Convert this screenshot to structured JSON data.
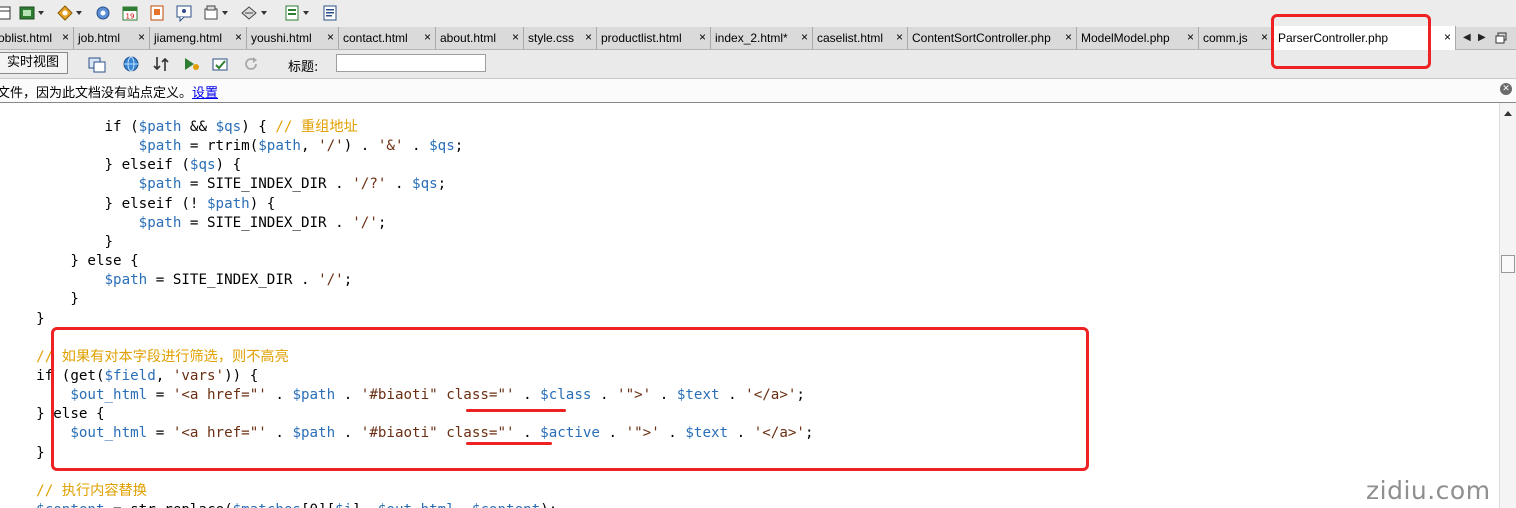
{
  "toolbar": {
    "icons": [
      "layout-icon",
      "insert-icon",
      "design-icon",
      "settings-icon",
      "calendar-icon",
      "template-icon",
      "preview-icon",
      "code-view-icon",
      "format-icon",
      "document-icon",
      "clipboard-icon"
    ]
  },
  "tabs": [
    {
      "label": "oblist.html",
      "close": "×"
    },
    {
      "label": "job.html",
      "close": "×"
    },
    {
      "label": "jiameng.html",
      "close": "×"
    },
    {
      "label": "youshi.html",
      "close": "×"
    },
    {
      "label": "contact.html",
      "close": "×"
    },
    {
      "label": "about.html",
      "close": "×"
    },
    {
      "label": "style.css",
      "close": "×"
    },
    {
      "label": "productlist.html",
      "close": "×"
    },
    {
      "label": "index_2.html*",
      "close": "×"
    },
    {
      "label": "caselist.html",
      "close": "×"
    },
    {
      "label": "ContentSortController.php",
      "close": "×"
    },
    {
      "label": "ModelModel.php",
      "close": "×"
    },
    {
      "label": "comm.js",
      "close": "×"
    },
    {
      "label": "ParserController.php",
      "close": "×"
    }
  ],
  "doc_toolbar": {
    "live_view_label": "实时视图",
    "title_label": "标题:",
    "title_value": ""
  },
  "info_bar": {
    "message": "文件，因为此文档没有站点定义。",
    "link_label": "设置"
  },
  "code_lines": [
    [
      [
        "            ",
        "o"
      ],
      [
        "if (",
        "o"
      ],
      [
        "$path",
        "v"
      ],
      [
        " && ",
        "o"
      ],
      [
        "$qs",
        "v"
      ],
      [
        ") { ",
        "o"
      ],
      [
        "// 重组地址",
        "c"
      ]
    ],
    [
      [
        "                ",
        "o"
      ],
      [
        "$path",
        "v"
      ],
      [
        " = rtrim(",
        "o"
      ],
      [
        "$path",
        "v"
      ],
      [
        ", ",
        "o"
      ],
      [
        "'/'",
        "s"
      ],
      [
        ") . ",
        "o"
      ],
      [
        "'&'",
        "s"
      ],
      [
        " . ",
        "o"
      ],
      [
        "$qs",
        "v"
      ],
      [
        ";",
        "o"
      ]
    ],
    [
      [
        "            } elseif (",
        "o"
      ],
      [
        "$qs",
        "v"
      ],
      [
        ") {",
        "o"
      ]
    ],
    [
      [
        "                ",
        "o"
      ],
      [
        "$path",
        "v"
      ],
      [
        " = SITE_INDEX_DIR . ",
        "o"
      ],
      [
        "'/?'",
        "s"
      ],
      [
        " . ",
        "o"
      ],
      [
        "$qs",
        "v"
      ],
      [
        ";",
        "o"
      ]
    ],
    [
      [
        "            } elseif (! ",
        "o"
      ],
      [
        "$path",
        "v"
      ],
      [
        ") {",
        "o"
      ]
    ],
    [
      [
        "                ",
        "o"
      ],
      [
        "$path",
        "v"
      ],
      [
        " = SITE_INDEX_DIR . ",
        "o"
      ],
      [
        "'/'",
        "s"
      ],
      [
        ";",
        "o"
      ]
    ],
    [
      [
        "            }",
        "o"
      ]
    ],
    [
      [
        "        } else {",
        "o"
      ]
    ],
    [
      [
        "            ",
        "o"
      ],
      [
        "$path",
        "v"
      ],
      [
        " = SITE_INDEX_DIR . ",
        "o"
      ],
      [
        "'/'",
        "s"
      ],
      [
        ";",
        "o"
      ]
    ],
    [
      [
        "        }",
        "o"
      ]
    ],
    [
      [
        "    }",
        "o"
      ]
    ],
    [
      [
        "",
        "o"
      ]
    ],
    [
      [
        "    ",
        "o"
      ],
      [
        "// 如果有对本字段进行筛选，则不高亮",
        "c"
      ]
    ],
    [
      [
        "    if (get(",
        "o"
      ],
      [
        "$field",
        "v"
      ],
      [
        ", ",
        "o"
      ],
      [
        "'vars'",
        "s"
      ],
      [
        ")) {",
        "o"
      ]
    ],
    [
      [
        "        ",
        "o"
      ],
      [
        "$out_html",
        "v"
      ],
      [
        " = ",
        "o"
      ],
      [
        "'<a href=\"'",
        "s"
      ],
      [
        " . ",
        "o"
      ],
      [
        "$path",
        "v"
      ],
      [
        " . ",
        "o"
      ],
      [
        "'#biaoti\" class=\"'",
        "s"
      ],
      [
        " . ",
        "o"
      ],
      [
        "$class",
        "v"
      ],
      [
        " . ",
        "o"
      ],
      [
        "'\">'",
        "s"
      ],
      [
        " . ",
        "o"
      ],
      [
        "$text",
        "v"
      ],
      [
        " . ",
        "o"
      ],
      [
        "'</a>'",
        "s"
      ],
      [
        ";",
        "o"
      ]
    ],
    [
      [
        "    } else {",
        "o"
      ]
    ],
    [
      [
        "        ",
        "o"
      ],
      [
        "$out_html",
        "v"
      ],
      [
        " = ",
        "o"
      ],
      [
        "'<a href=\"'",
        "s"
      ],
      [
        " . ",
        "o"
      ],
      [
        "$path",
        "v"
      ],
      [
        " . ",
        "o"
      ],
      [
        "'#biaoti\" class=\"'",
        "s"
      ],
      [
        " . ",
        "o"
      ],
      [
        "$active",
        "v"
      ],
      [
        " . ",
        "o"
      ],
      [
        "'\">'",
        "s"
      ],
      [
        " . ",
        "o"
      ],
      [
        "$text",
        "v"
      ],
      [
        " . ",
        "o"
      ],
      [
        "'</a>'",
        "s"
      ],
      [
        ";",
        "o"
      ]
    ],
    [
      [
        "    }",
        "o"
      ]
    ],
    [
      [
        "",
        "o"
      ]
    ],
    [
      [
        "    ",
        "o"
      ],
      [
        "// 执行内容替换",
        "c"
      ]
    ],
    [
      [
        "    ",
        "o"
      ],
      [
        "$content",
        "v"
      ],
      [
        " = str_replace(",
        "o"
      ],
      [
        "$matches",
        "v"
      ],
      [
        "[0][",
        "o"
      ],
      [
        "$i",
        "v"
      ],
      [
        "], ",
        "o"
      ],
      [
        "$out_html",
        "v"
      ],
      [
        ", ",
        "o"
      ],
      [
        "$content",
        "v"
      ],
      [
        ");",
        "o"
      ]
    ]
  ],
  "watermark": "zidiu.com",
  "colors": {
    "annotation": "#EE2222",
    "variable": "#2A6FB7",
    "string": "#6B2F13",
    "comment": "#E0A000"
  }
}
